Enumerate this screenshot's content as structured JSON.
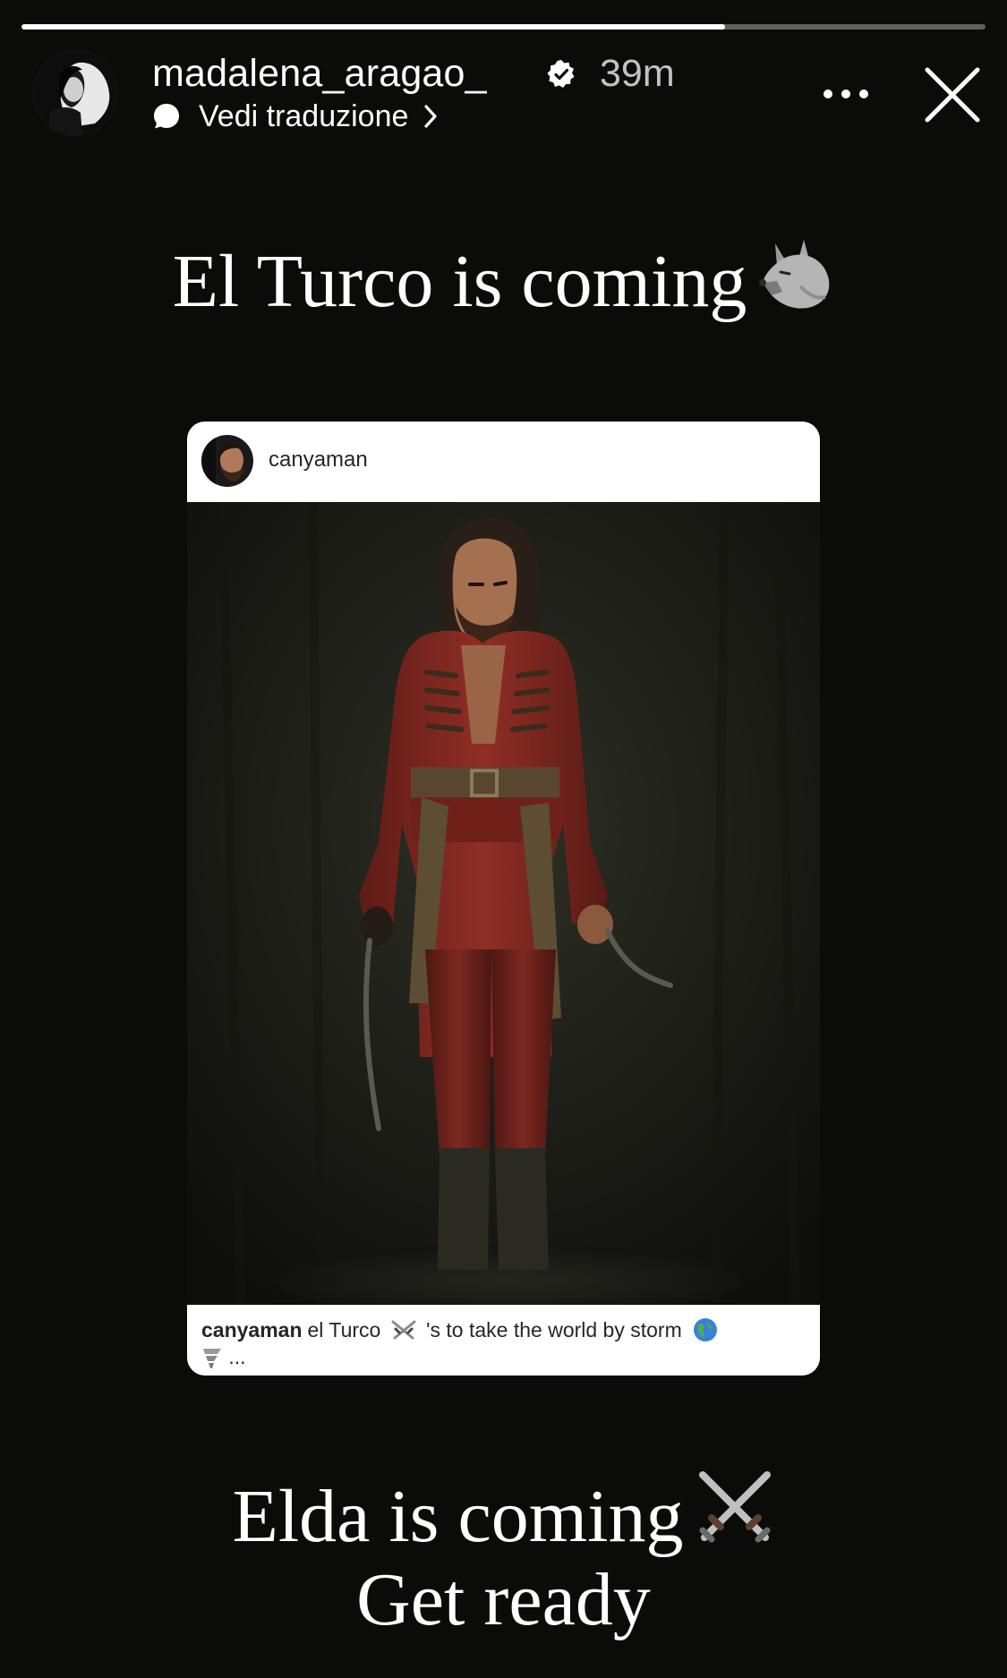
{
  "story": {
    "progress": 0.73,
    "username": "madalena_aragao_",
    "verified": true,
    "timestamp": "39m",
    "translate_label": "Vedi traduzione",
    "icons": {
      "verified": "verified-badge-icon",
      "translate": "speech-bubble-icon",
      "chevron": "chevron-right-icon",
      "more": "more-options-icon",
      "close": "close-icon"
    }
  },
  "text_overlays": {
    "line1": "El Turco is coming",
    "line1_emoji": "wolf-emoji",
    "line2": "Elda is coming",
    "line2_emoji": "crossed-swords-emoji",
    "line3": "Get ready"
  },
  "shared_post": {
    "username": "canyaman",
    "caption_user": "canyaman",
    "caption_text_1": "el Turco",
    "caption_text_2": "'s to take the world by storm",
    "caption_more": "...",
    "caption_emojis": [
      "crossed-swords-emoji",
      "globe-emoji",
      "tornado-emoji"
    ]
  },
  "colors": {
    "background": "#0b0b0a",
    "text": "#ffffff",
    "card": "#ffffff",
    "costume_red": "#8b2a22"
  }
}
